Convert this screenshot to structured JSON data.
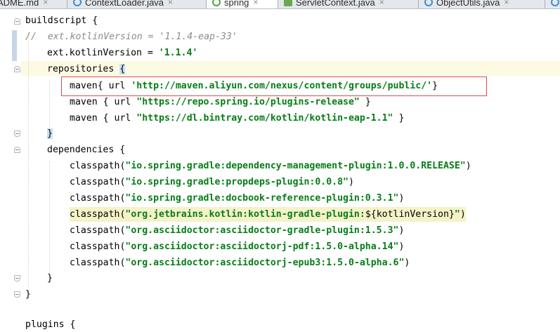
{
  "tabs": [
    {
      "label": "ADME.md",
      "icon": "markdown-file-icon",
      "active": false
    },
    {
      "label": "ContextLoader.java",
      "icon": "java-class-icon",
      "active": false
    },
    {
      "label": "spring",
      "icon": "gradle-file-icon",
      "active": true
    },
    {
      "label": "ServletContext.java",
      "icon": "java-interface-icon",
      "active": false
    },
    {
      "label": "ObjectUtils.java",
      "icon": "java-class-icon",
      "active": false
    }
  ],
  "code": {
    "l1_a": "buildscript {",
    "l2_comment": "//  ext.kotlinVersion = '1.1.4-eap-33'",
    "l3_a": "ext.kotlinVersion = ",
    "l3_str": "'1.1.4'",
    "l4_a": "repositories ",
    "l4_brace": "{",
    "l5_a": "maven{ url ",
    "l5_str": "'http://maven.aliyun.com/nexus/content/groups/public/'",
    "l5_b": "}",
    "l6_a": "maven { url ",
    "l6_str": "\"https://repo.spring.io/plugins-release\"",
    "l6_b": " }",
    "l7_a": "maven { url ",
    "l7_str": "\"https://dl.bintray.com/kotlin/kotlin-eap-1.1\"",
    "l7_b": " }",
    "l8_brace": "}",
    "l9_a": "dependencies {",
    "cp_fn": "classpath(",
    "l10_str": "\"io.spring.gradle:dependency-management-plugin:1.0.0.RELEASE\"",
    "l11_str": "\"io.spring.gradle:propdeps-plugin:0.0.8\"",
    "l12_str": "\"io.spring.gradle:docbook-reference-plugin:0.3.1\"",
    "l13_str_a": "\"org.jetbrains.kotlin:kotlin-gradle-plugin:",
    "l13_interp": "${kotlinVersion}",
    "l13_str_b": "\"",
    "l14_str": "\"org.asciidoctor:asciidoctor-gradle-plugin:1.5.3\"",
    "l15_str": "\"org.asciidoctor:asciidoctorj-pdf:1.5.0-alpha.14\"",
    "l16_str": "\"org.asciidoctor:asciidoctorj-epub3:1.5.0-alpha.6\"",
    "close_paren": ")",
    "l17_brace": "}",
    "l18_brace": "}",
    "l19_a": "plugins {"
  },
  "colors": {
    "string": "#067d17",
    "comment": "#8c8c8c",
    "caret_line": "#fcfae2",
    "annotation_box": "#e24a4a"
  }
}
